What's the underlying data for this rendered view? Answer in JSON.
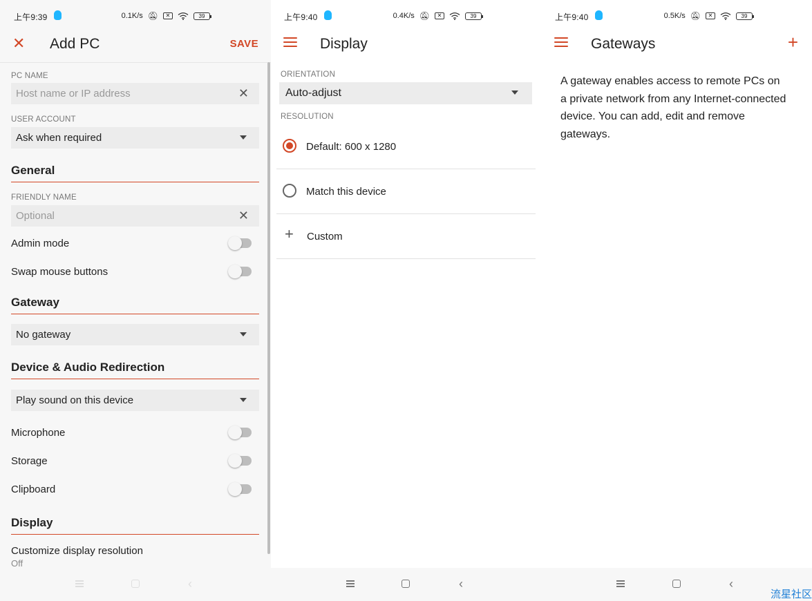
{
  "status_bars": [
    {
      "time": "上午9:39",
      "speed": "0.1K/s",
      "battery": "39"
    },
    {
      "time": "上午9:40",
      "speed": "0.4K/s",
      "battery": "39"
    },
    {
      "time": "上午9:40",
      "speed": "0.5K/s",
      "battery": "39"
    }
  ],
  "add_pc": {
    "title": "Add PC",
    "save_label": "SAVE",
    "pc_name_label": "PC NAME",
    "pc_name_placeholder": "Host name or IP address",
    "user_account_label": "USER ACCOUNT",
    "user_account_value": "Ask when required",
    "general_title": "General",
    "friendly_name_label": "FRIENDLY NAME",
    "friendly_name_placeholder": "Optional",
    "admin_mode": "Admin mode",
    "swap_mouse": "Swap mouse buttons",
    "gateway_title": "Gateway",
    "gateway_value": "No gateway",
    "redirection_title": "Device & Audio Redirection",
    "sound_value": "Play sound on this device",
    "microphone": "Microphone",
    "storage": "Storage",
    "clipboard": "Clipboard",
    "display_title": "Display",
    "customize_resolution": "Customize display resolution",
    "customize_resolution_value": "Off"
  },
  "display": {
    "title": "Display",
    "orientation_label": "ORIENTATION",
    "orientation_value": "Auto-adjust",
    "resolution_label": "RESOLUTION",
    "options": [
      {
        "label": "Default: 600 x 1280",
        "selected": true
      },
      {
        "label": "Match this device",
        "selected": false
      }
    ],
    "custom_label": "Custom"
  },
  "gateways": {
    "title": "Gateways",
    "description": "A gateway enables access to remote PCs on a private network from any Internet-connected device. You can add, edit and remove gateways."
  },
  "watermark": "流星社区",
  "colors": {
    "accent": "#d24726",
    "field_bg": "#ececec",
    "qq_blue": "#1fb6ff"
  }
}
